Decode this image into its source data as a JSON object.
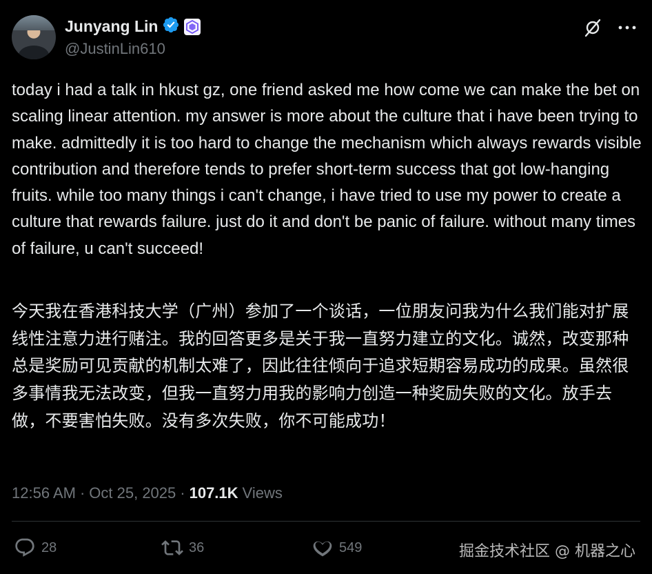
{
  "author": {
    "display_name": "Junyang Lin",
    "handle": "@JustinLin610"
  },
  "tweet": {
    "text_en": "today i had a talk in hkust gz, one friend asked me how come we can make the bet on scaling linear attention. my answer is more about the culture that i have been trying to make. admittedly it is too hard to change the mechanism which always rewards visible contribution and therefore tends to prefer short-term success that got low-hanging fruits. while too many things i can't change, i have tried to use my power to create a culture that rewards failure. just do it and don't be panic of failure. without many times of failure, u can't succeed!",
    "text_zh": "今天我在香港科技大学（广州）参加了一个谈话，一位朋友问我为什么我们能对扩展线性注意力进行赌注。我的回答更多是关于我一直努力建立的文化。诚然，改变那种总是奖励可见贡献的机制太难了，因此往往倾向于追求短期容易成功的成果。虽然很多事情我无法改变，但我一直努力用我的影响力创造一种奖励失败的文化。放手去做，不要害怕失败。没有多次失败，你不可能成功！",
    "time": "12:56 AM",
    "date": "Oct 25, 2025",
    "separator": "·",
    "views_count": "107.1K",
    "views_label": "Views"
  },
  "stats": {
    "replies": "28",
    "reposts": "36",
    "likes": "549"
  },
  "watermark": "掘金技术社区 @ 机器之心",
  "icons": {
    "verified": "verified-badge-icon",
    "affiliate": "affiliate-logo-icon",
    "grok": "grok-icon",
    "more": "more-icon",
    "reply": "reply-icon",
    "repost": "repost-icon",
    "like": "like-icon"
  },
  "colors": {
    "background": "#000000",
    "text": "#e7e9ea",
    "muted": "#71767b",
    "verified": "#1d9bf0",
    "affiliate": "#6c4df5"
  }
}
